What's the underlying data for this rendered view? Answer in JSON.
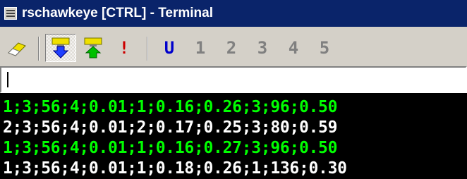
{
  "window": {
    "title": "rschawkeye [CTRL] - Terminal",
    "icon": "terminal-window-icon",
    "colors": {
      "titlebar": "#0a246a",
      "title_text": "#ffffff",
      "chrome": "#d4d0c8"
    }
  },
  "toolbar": {
    "buttons": [
      {
        "name": "clear-button",
        "icon": "eraser-icon",
        "pressed": false
      },
      {
        "name": "receive-button",
        "icon": "down-arrow-download-icon",
        "pressed": true
      },
      {
        "name": "send-button",
        "icon": "up-arrow-upload-icon",
        "pressed": false
      },
      {
        "name": "break-button",
        "label": "!",
        "color": "#cc0000"
      },
      {
        "name": "user-button",
        "label": "U",
        "color": "#0000cc"
      },
      {
        "name": "macro-button-1",
        "label": "1",
        "color": "#808080"
      },
      {
        "name": "macro-button-2",
        "label": "2",
        "color": "#808080"
      },
      {
        "name": "macro-button-3",
        "label": "3",
        "color": "#808080"
      },
      {
        "name": "macro-button-4",
        "label": "4",
        "color": "#808080"
      },
      {
        "name": "macro-button-5",
        "label": "5",
        "color": "#808080"
      }
    ]
  },
  "command_input": {
    "value": "",
    "placeholder": ""
  },
  "terminal": {
    "background": "#000000",
    "lines": [
      {
        "text": "1;3;56;4;0.01;1;0.16;0.26;3;96;0.50",
        "color": "#00ff00"
      },
      {
        "text": "2;3;56;4;0.01;2;0.17;0.25;3;80;0.59",
        "color": "#ffffff"
      },
      {
        "text": "1;3;56;4;0.01;1;0.16;0.27;3;96;0.50",
        "color": "#00ff00"
      },
      {
        "text": "1;3;56;4;0.01;1;0.18;0.26;1;136;0.30",
        "color": "#ffffff"
      }
    ]
  }
}
